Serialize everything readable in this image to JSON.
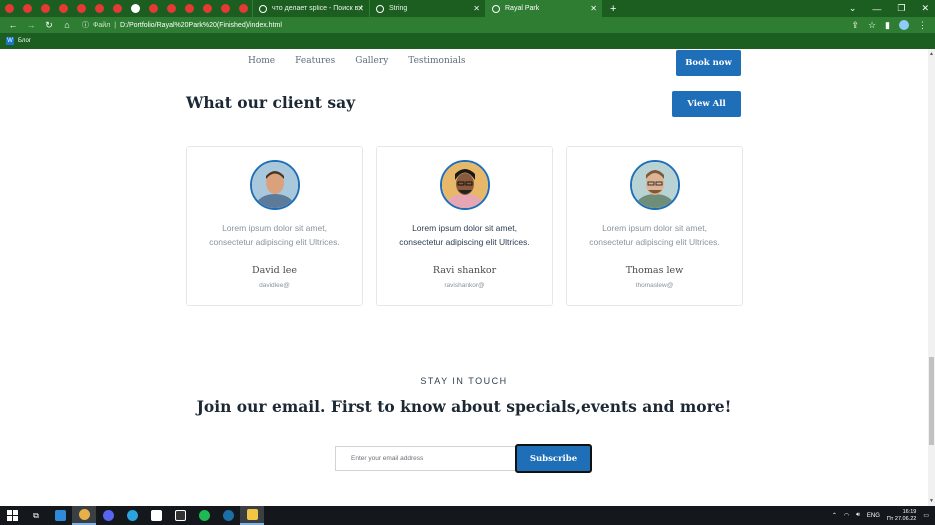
{
  "browser": {
    "mini_tab_colors": [
      "#e53935",
      "#e53935",
      "#e53935",
      "#e53935",
      "#e53935",
      "#e53935",
      "#e53935",
      "#fff",
      "#e53935",
      "#e53935",
      "#e53935",
      "#e53935",
      "#e53935",
      "#e53935",
      "#c6d96b",
      "#d84315",
      "#66bb6a",
      "#ef5350",
      "#ffb300",
      "#c6d96b",
      "#c6d96b",
      "#4fc3f7",
      "#c6d96b",
      "#ff7043",
      "#fdd835",
      "#e53935",
      "#e53935",
      "#ff7043",
      "#1e88e5",
      "#1e88e5",
      "#43a047"
    ],
    "tabs": [
      {
        "title": "что делает splice - Поиск в Goo",
        "active": false
      },
      {
        "title": "String",
        "active": false
      },
      {
        "title": "Rayal Park",
        "active": true
      }
    ],
    "address": {
      "info_label": "Файл",
      "url": "D:/Portfolio/Rayal%20Park%20(Finished)/index.html"
    },
    "bookmark": {
      "icon": "W",
      "label": "Блог"
    }
  },
  "site": {
    "nav": [
      "Home",
      "Features",
      "Gallery",
      "Testimonials"
    ],
    "book_now": "Book now",
    "section_title": "What our client say",
    "view_all": "View All",
    "testimonials": [
      {
        "quote_line1": "Lorem ipsum dolor sit amet,",
        "quote_line2": "consectetur adipiscing elit Ultrices.",
        "name": "David lee",
        "handle": "davidlee@",
        "highlighted": false
      },
      {
        "quote_line1": "Lorem ipsum dolor sit amet,",
        "quote_line2": "consectetur adipiscing elit Ultrices.",
        "name": "Ravi shankor",
        "handle": "ravishankor@",
        "highlighted": true
      },
      {
        "quote_line1": "Lorem ipsum dolor sit amet,",
        "quote_line2": "consectetur adipiscing elit Ultrices.",
        "name": "Thomas lew",
        "handle": "thomaslew@",
        "highlighted": false
      }
    ],
    "stay_label": "STAY IN TOUCH",
    "join_title": "Join our email. First to know about specials,events and more!",
    "email_placeholder": "Enter your email address",
    "subscribe": "Subscribe",
    "accent_color": "#1e6fb8"
  },
  "taskbar": {
    "language": "ENG",
    "time": "16:19",
    "date": "Пт 27.06.22"
  }
}
